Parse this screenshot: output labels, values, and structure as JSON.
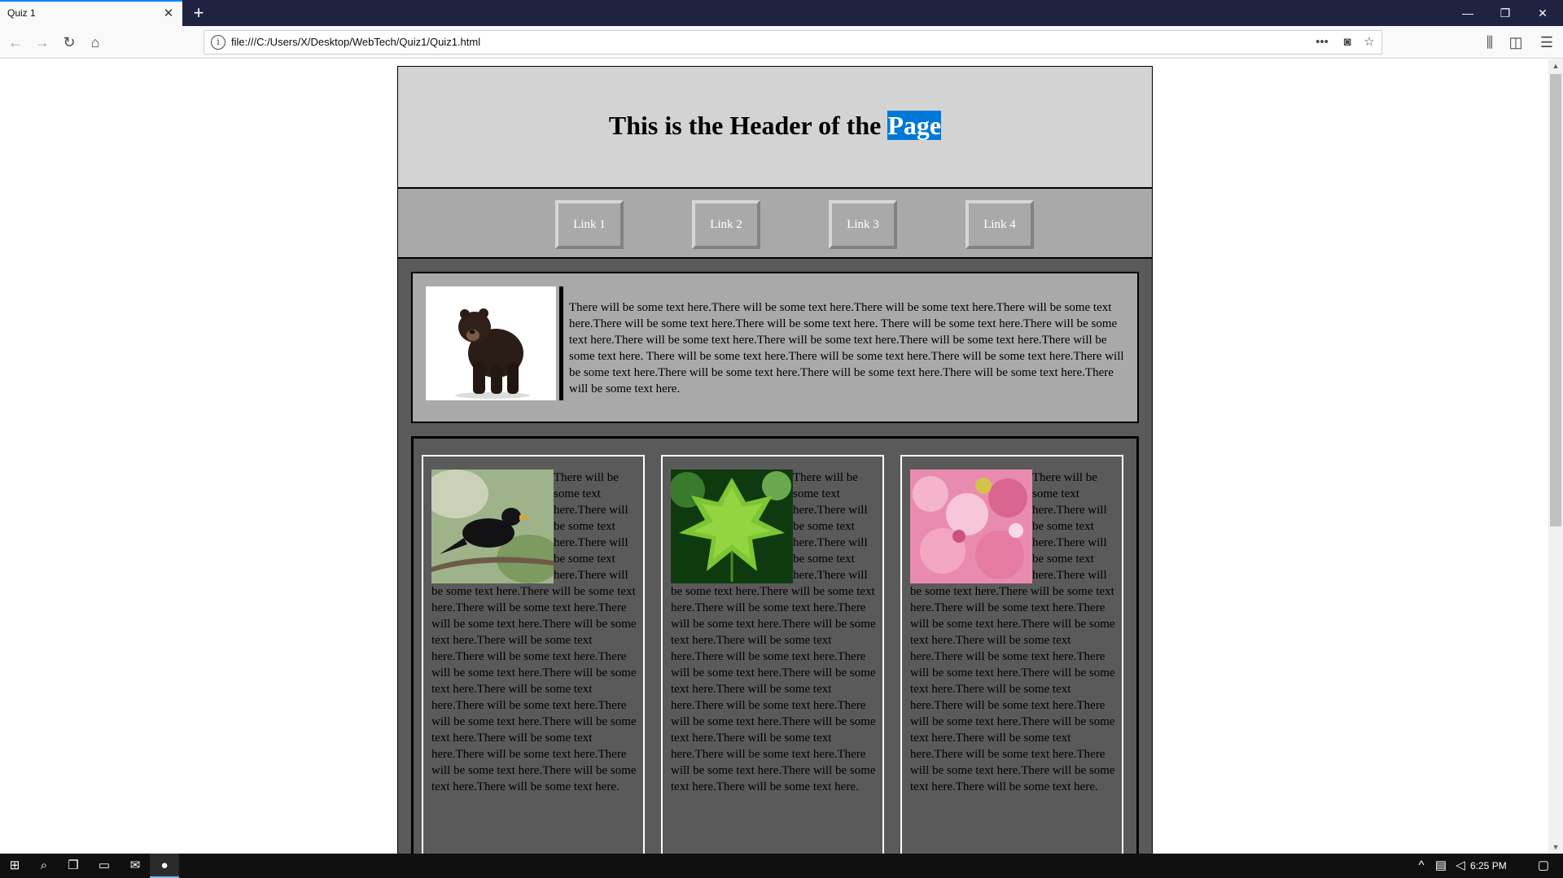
{
  "browser": {
    "tab_title": "Quiz 1",
    "close_glyph": "✕",
    "new_tab_glyph": "+",
    "url": "file:///C:/Users/X/Desktop/WebTech/Quiz1/Quiz1.html",
    "icons": [
      "back-icon",
      "forward-icon",
      "reload-icon",
      "home-icon",
      "info-icon",
      "more-actions-icon",
      "pocket-icon",
      "bookmark-star-icon",
      "library-icon",
      "sidebar-icon",
      "menu-icon"
    ]
  },
  "page": {
    "header_title_main": "This is the Header of the ",
    "header_title_selected": "Page",
    "nav_links": [
      "Link 1",
      "Link 2",
      "Link 3",
      "Link 4"
    ],
    "feature_text": "There will be some text here.There will be some text here.There will be some text here.There will be some text here.There will be some text here.There will be some text here. There will be some text here.There will be some text here.There will be some text here.There will be some text here.There will be some text here.There will be some text here. There will be some text here.There will be some text here.There will be some text here.There will be some text here.There will be some text here.There will be some text here.There will be some text here.There will be some text here.",
    "card_text": "There will be some text here.There will be some text here.There will be some text here.There will be some text here.There will be some text here.There will be some text here.There will be some text here.There will be some text here.There will be some text here.There will be some text here.There will be some text here.There will be some text here.There will be some text here.There will be some text here.There will be some text here.There will be some text here.There will be some text here.There will be some text here.There will be some text here.There will be some text here.There will be some text here.",
    "card_images": [
      "blackbird-photo",
      "maple-leaf-photo",
      "cherry-blossom-photo"
    ]
  },
  "taskbar": {
    "time": "6:25 PM"
  }
}
